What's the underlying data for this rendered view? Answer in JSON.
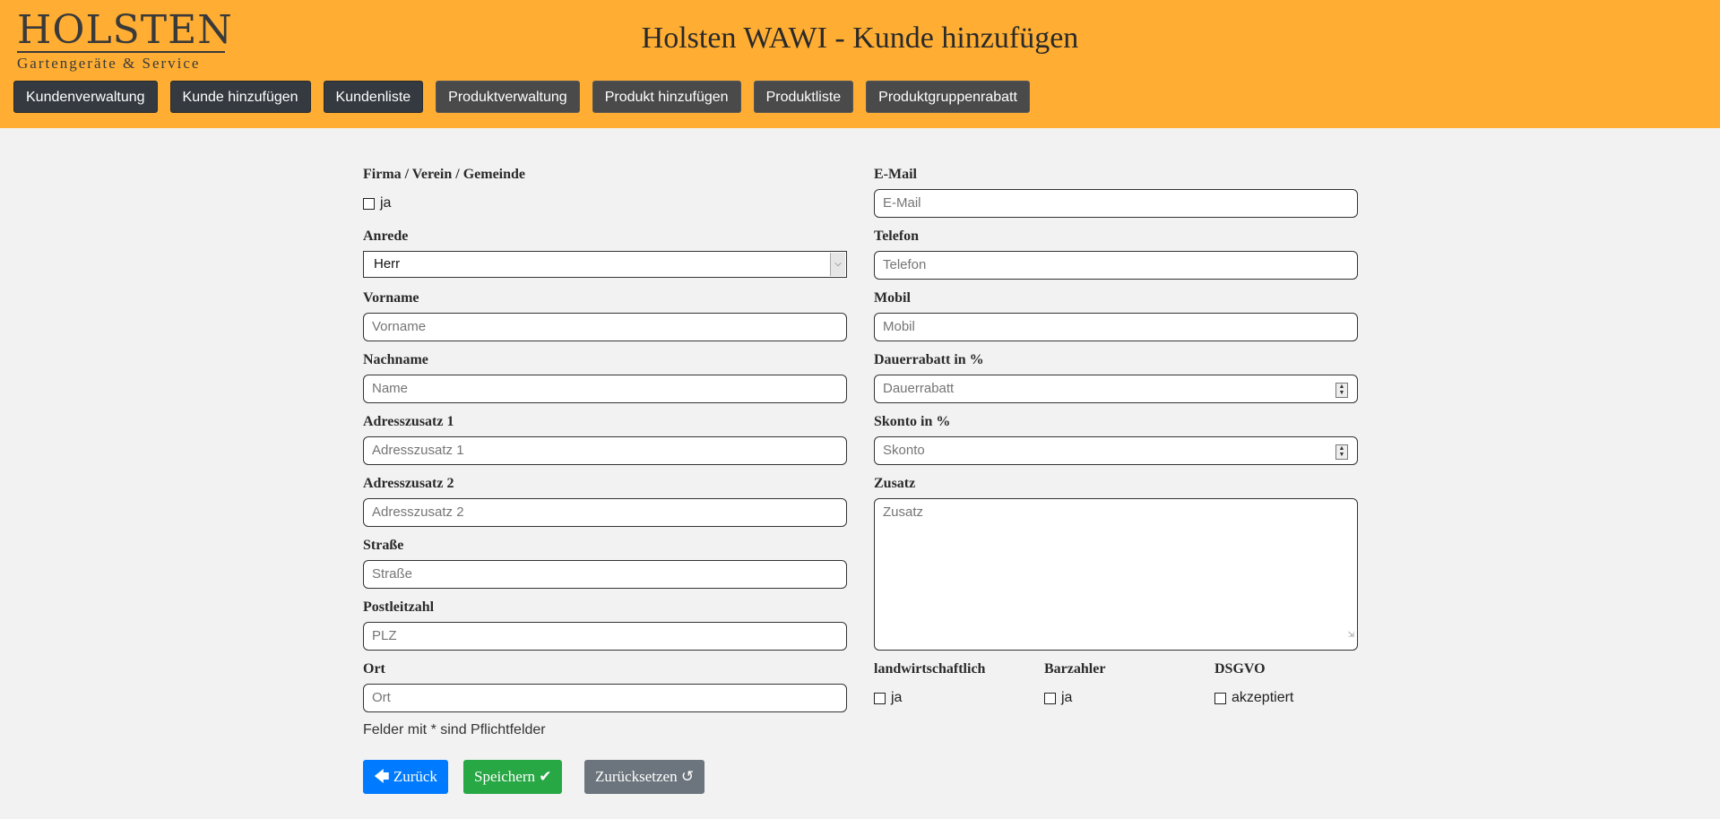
{
  "header": {
    "logo_word": "HOLSTEN",
    "logo_sub": "Gartengeräte & Service",
    "title": "Holsten WAWI - Kunde hinzufügen",
    "nav": [
      {
        "label": "Kundenverwaltung"
      },
      {
        "label": "Kunde hinzufügen"
      },
      {
        "label": "Kundenliste"
      },
      {
        "label": "Produktverwaltung"
      },
      {
        "label": "Produkt hinzufügen"
      },
      {
        "label": "Produktliste"
      },
      {
        "label": "Produktgruppenrabatt"
      }
    ]
  },
  "form": {
    "firma": {
      "label": "Firma / Verein / Gemeinde",
      "check_label": "ja"
    },
    "anrede": {
      "label": "Anrede",
      "value": "Herr"
    },
    "vorname": {
      "label": "Vorname",
      "placeholder": "Vorname"
    },
    "nachname": {
      "label": "Nachname",
      "placeholder": "Name"
    },
    "adresszusatz1": {
      "label": "Adresszusatz 1",
      "placeholder": "Adresszusatz 1"
    },
    "adresszusatz2": {
      "label": "Adresszusatz 2",
      "placeholder": "Adresszusatz 2"
    },
    "strasse": {
      "label": "Straße",
      "placeholder": "Straße"
    },
    "plz": {
      "label": "Postleitzahl",
      "placeholder": "PLZ"
    },
    "ort": {
      "label": "Ort",
      "placeholder": "Ort"
    },
    "email": {
      "label": "E-Mail",
      "placeholder": "E-Mail"
    },
    "telefon": {
      "label": "Telefon",
      "placeholder": "Telefon"
    },
    "mobil": {
      "label": "Mobil",
      "placeholder": "Mobil"
    },
    "dauerrabatt": {
      "label": "Dauerrabatt in %",
      "placeholder": "Dauerrabatt"
    },
    "skonto": {
      "label": "Skonto in %",
      "placeholder": "Skonto"
    },
    "zusatz": {
      "label": "Zusatz",
      "placeholder": "Zusatz"
    },
    "landwirtschaftlich": {
      "label": "landwirtschaftlich",
      "check_label": "ja"
    },
    "barzahler": {
      "label": "Barzahler",
      "check_label": "ja"
    },
    "dsgvo": {
      "label": "DSGVO",
      "check_label": "akzeptiert"
    },
    "note": "Felder mit * sind Pflichtfelder"
  },
  "buttons": {
    "back": "Zurück",
    "save": "Speichern",
    "reset": "Zurücksetzen"
  },
  "colors": {
    "header_bg": "#ffae33",
    "back_btn": "#007bff",
    "save_btn": "#28a745",
    "reset_btn": "#6c757d"
  }
}
